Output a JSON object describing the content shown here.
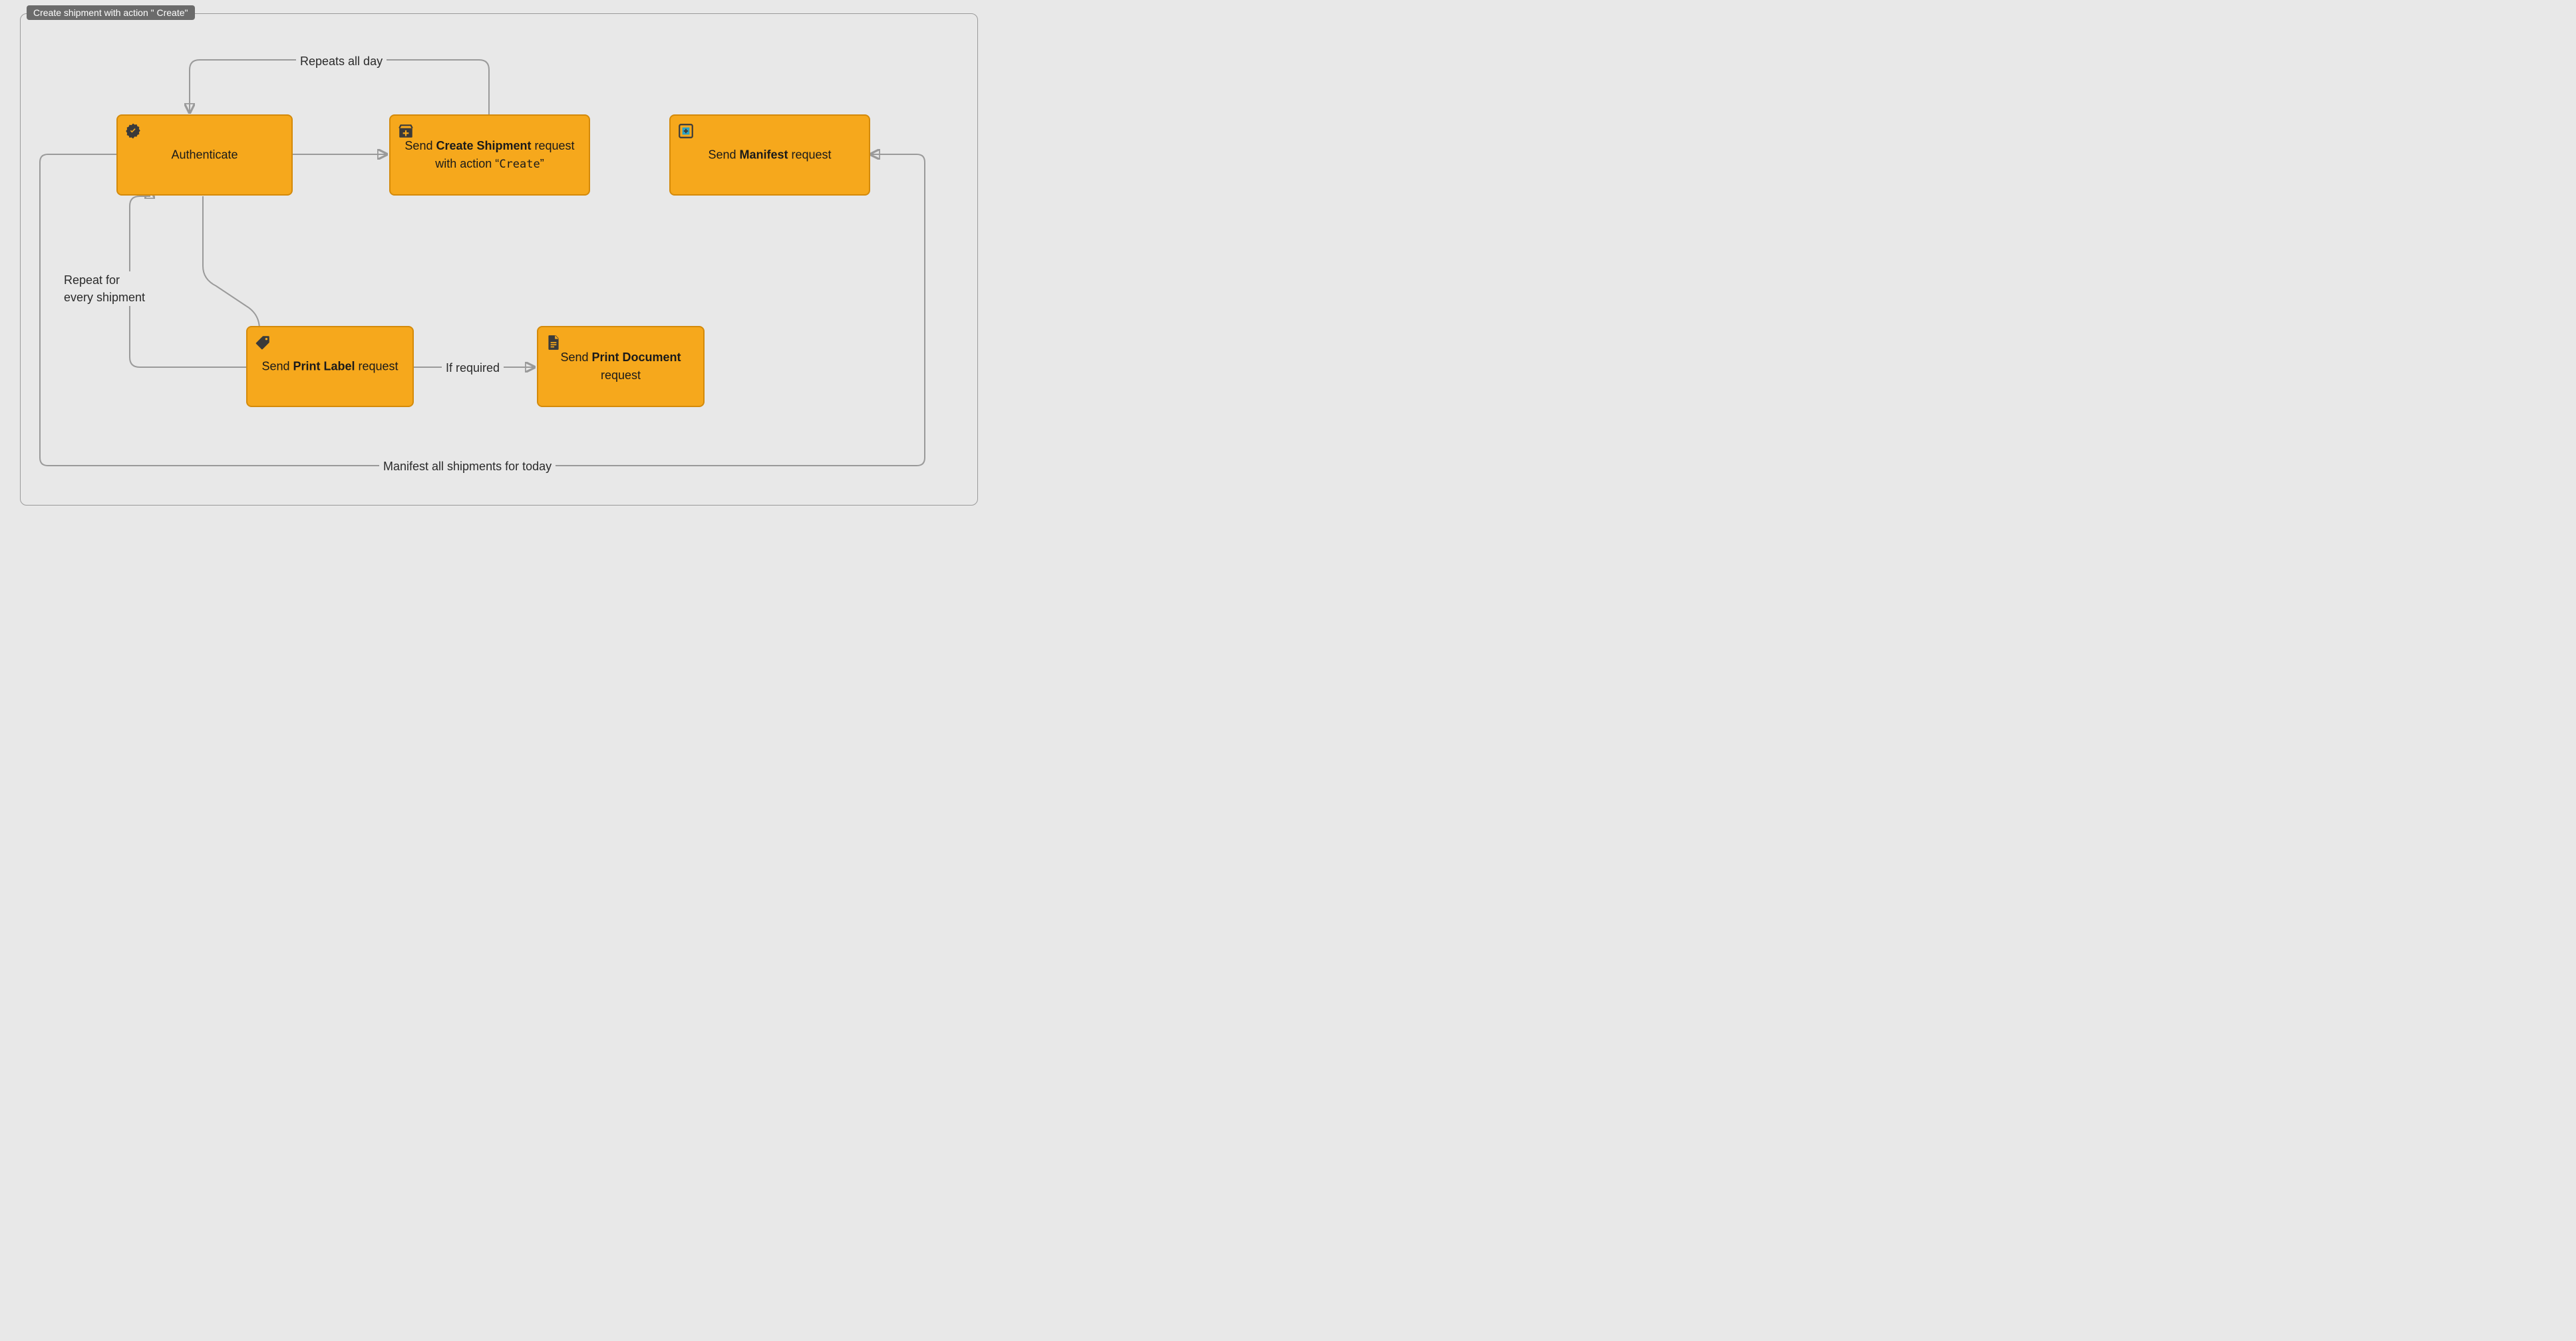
{
  "title": "Create shipment with action \" Create\"",
  "nodes": {
    "authenticate": {
      "label": "Authenticate"
    },
    "create_shipment": {
      "pre": "Send ",
      "bold": "Create Shipment",
      "post": " request",
      "line2_pre": "with action “",
      "line2_code": "Create",
      "line2_post": "”"
    },
    "manifest": {
      "pre": "Send ",
      "bold": "Manifest",
      "post": " request"
    },
    "print_label": {
      "pre": "Send ",
      "bold": "Print Label",
      "post": " request"
    },
    "print_document": {
      "pre": "Send ",
      "bold": "Print Document",
      "post": "",
      "line2": "request"
    }
  },
  "edges": {
    "repeats_all_day": "Repeats all day",
    "repeat_every_shipment_l1": "Repeat for",
    "repeat_every_shipment_l2": "every shipment",
    "if_required": "If required",
    "manifest_today": "Manifest all shipments for today"
  }
}
